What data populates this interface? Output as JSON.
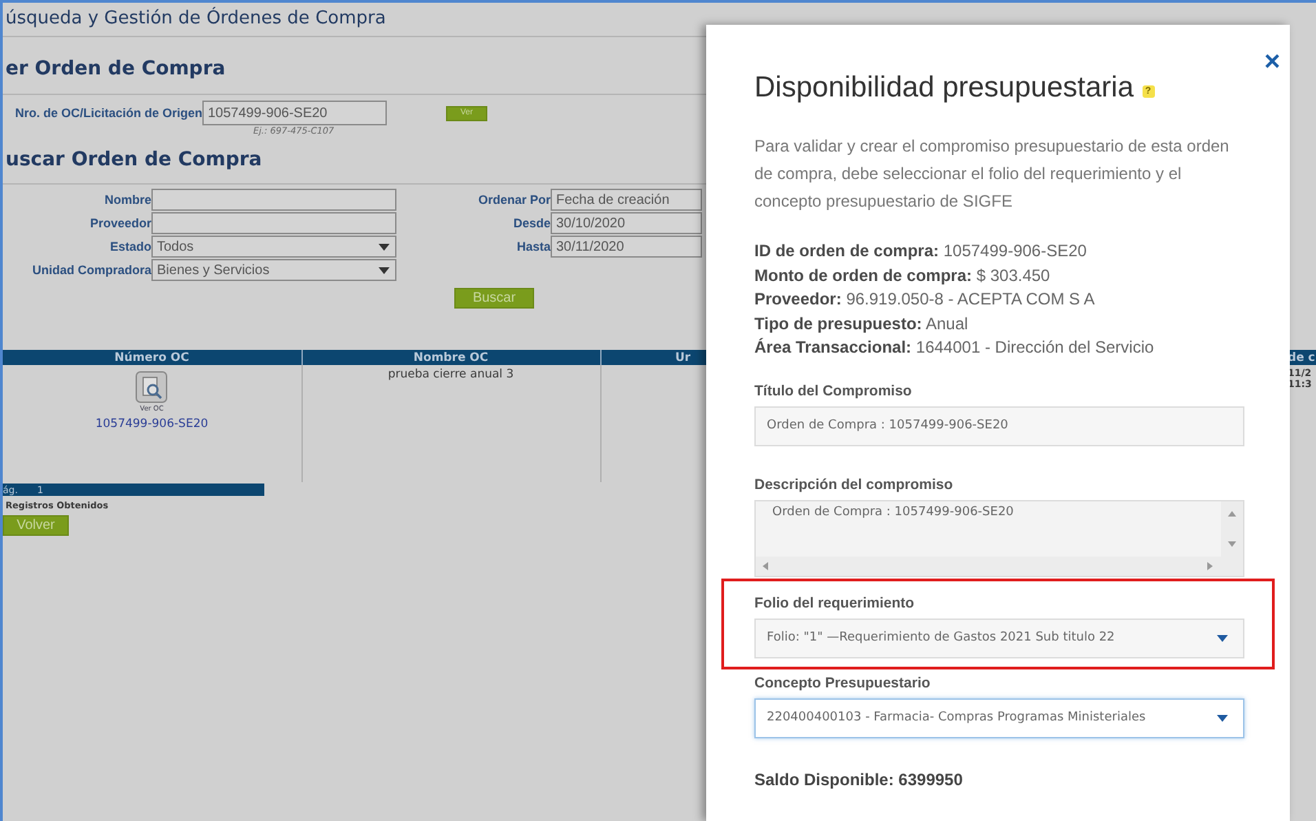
{
  "page": {
    "title": "úsqueda y Gestión de Órdenes de Compra",
    "view_section": {
      "heading": "er Orden de Compra",
      "label": "Nro. de OC/Licitación de Origen",
      "value": "1057499-906-SE20",
      "hint": "Ej.: 697-475-C107",
      "button": "Ver"
    },
    "search_section": {
      "heading": "uscar Orden de Compra",
      "left_fields": [
        {
          "kind": "text",
          "label": "Nombre"
        },
        {
          "kind": "text",
          "label": "Proveedor"
        },
        {
          "kind": "select",
          "label": "Estado",
          "value": "Todos"
        },
        {
          "kind": "select",
          "label": "Unidad Compradora",
          "value": "Bienes y Servicios"
        }
      ],
      "right_fields": [
        {
          "label": "Ordenar Por",
          "value": "Fecha de creación"
        },
        {
          "label": "Desde",
          "value": "30/10/2020"
        },
        {
          "label": "Hasta",
          "value": "30/11/2020"
        }
      ],
      "button": "Buscar"
    },
    "table": {
      "columns": [
        "Número OC",
        "Nombre OC",
        "Ur",
        "de c"
      ],
      "rows": [
        {
          "icon_label": "Ver OC",
          "number": "1057499-906-SE20",
          "name": "prueba cierre anual 3",
          "column_4": [
            "11/2",
            "11:3"
          ]
        }
      ]
    },
    "pager": {
      "label": "ág.",
      "page": "1"
    },
    "records_label": "Registros Obtenidos",
    "back_button": "Volver"
  },
  "modal": {
    "close": "×",
    "title": "Disponibilidad presupuestaria",
    "help": "?",
    "intro": "Para validar y crear el compromiso presupuestario de esta orden de compra, debe seleccionar el folio del requerimiento y el concepto presupuestario de SIGFE",
    "details": [
      {
        "label": "ID de orden de compra:",
        "value": "1057499-906-SE20"
      },
      {
        "label": "Monto de orden de compra:",
        "value": "$ 303.450"
      },
      {
        "label": "Proveedor:",
        "value": "96.919.050-8 - ACEPTA COM S A"
      },
      {
        "label": "Tipo de presupuesto:",
        "value": "Anual"
      },
      {
        "label": "Área Transaccional:",
        "value": "1644001 - Dirección del Servicio"
      }
    ],
    "fields": [
      {
        "kind": "text",
        "label": "Título del Compromiso",
        "value": "Orden de Compra : 1057499-906-SE20",
        "highlighted": false,
        "focused": false
      },
      {
        "kind": "textarea",
        "label": "Descripción del compromiso",
        "value": "Orden de Compra : 1057499-906-SE20",
        "highlighted": false,
        "focused": false
      },
      {
        "kind": "select",
        "label": "Folio del requerimiento",
        "value": "Folio: \"1\" —Requerimiento de Gastos 2021 Sub titulo 22",
        "highlighted": true,
        "focused": false
      },
      {
        "kind": "select",
        "label": "Concepto Presupuestario",
        "value": "220400400103 - Farmacia- Compras Programas Ministeriales",
        "highlighted": false,
        "focused": true
      }
    ],
    "balance": "Saldo Disponible: 6399950"
  }
}
